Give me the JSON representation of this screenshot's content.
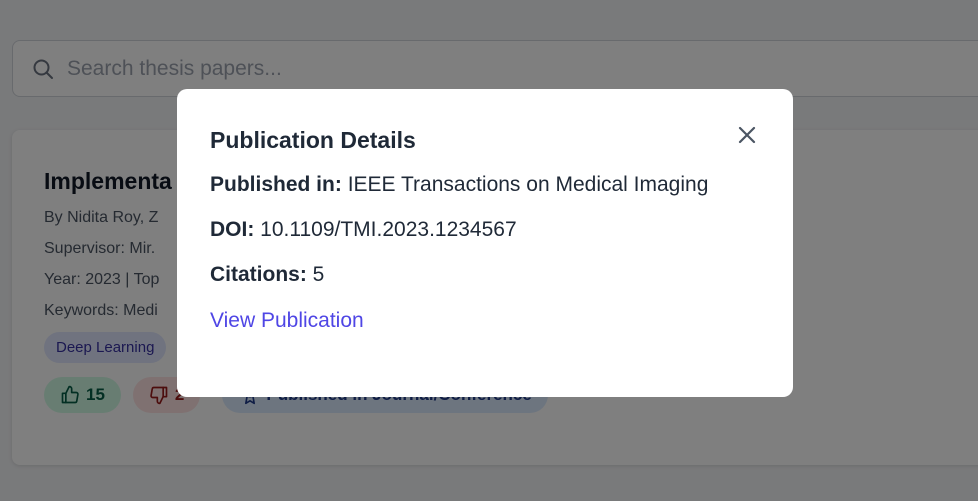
{
  "search": {
    "placeholder": "Search thesis papers..."
  },
  "card": {
    "title": "Implementa",
    "authors": "By Nidita Roy, Z",
    "supervisor": "Supervisor: Mir.",
    "year": "Year: 2023 | Top",
    "keywords": "Keywords: Medi",
    "tags": [
      "Deep Learning"
    ],
    "upvotes": "15",
    "downvotes": "2",
    "published_label": "Published in Journal/Conference"
  },
  "modal": {
    "title": "Publication Details",
    "published_in_label": "Published in:",
    "published_in_value": "IEEE Transactions on Medical Imaging",
    "doi_label": "DOI:",
    "doi_value": "10.1109/TMI.2023.1234567",
    "citations_label": "Citations:",
    "citations_value": "5",
    "link_label": "View Publication"
  },
  "colors": {
    "accent": "#4f46e5",
    "upvote_bg": "#d1fae5",
    "downvote_bg": "#fee2e2",
    "published_bg": "#dbeafe",
    "tag_bg": "#e0e7ff"
  },
  "icons": [
    "search-icon",
    "thumbs-up-icon",
    "thumbs-down-icon",
    "award-icon",
    "close-icon"
  ]
}
